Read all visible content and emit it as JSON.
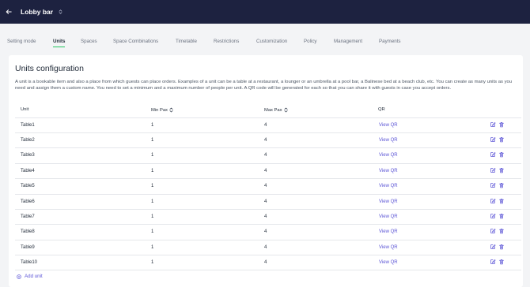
{
  "header": {
    "back_icon": "arrow-left-icon",
    "venue_name": "Lobby bar",
    "venue_caret_icon": "chevron-updown-icon"
  },
  "tabs": [
    {
      "label": "Setting mode",
      "active": false
    },
    {
      "label": "Units",
      "active": true
    },
    {
      "label": "Spaces",
      "active": false
    },
    {
      "label": "Space Combinations",
      "active": false
    },
    {
      "label": "Timetable",
      "active": false
    },
    {
      "label": "Restrictions",
      "active": false
    },
    {
      "label": "Customization",
      "active": false
    },
    {
      "label": "Policy",
      "active": false
    },
    {
      "label": "Management",
      "active": false
    },
    {
      "label": "Payments",
      "active": false
    }
  ],
  "main": {
    "title": "Units configuration",
    "description": "A unit is a bookable item and also a place from which guests can place orders. Examples of a unit can be a table at a restaurant, a lounger or an umbrella at a pool bar, a Balinese bed at a beach club, etc. You can create as many units as you need and assign them a custom name. You need to set a minimum and a maximum number of people per unit. A QR code will be generated for each so that you can share it with guests in case you accept orders."
  },
  "table": {
    "columns": [
      "Unit",
      "Min Pax",
      "Max Pax",
      "QR"
    ],
    "sort_icon": "sort-updown-icon",
    "rows": [
      {
        "unit": "Table1",
        "min_pax": "1",
        "max_pax": "4",
        "qr": "View QR"
      },
      {
        "unit": "Table2",
        "min_pax": "1",
        "max_pax": "4",
        "qr": "View QR"
      },
      {
        "unit": "Table3",
        "min_pax": "1",
        "max_pax": "4",
        "qr": "View QR"
      },
      {
        "unit": "Table4",
        "min_pax": "1",
        "max_pax": "4",
        "qr": "View QR"
      },
      {
        "unit": "Table5",
        "min_pax": "1",
        "max_pax": "4",
        "qr": "View QR"
      },
      {
        "unit": "Table6",
        "min_pax": "1",
        "max_pax": "4",
        "qr": "View QR"
      },
      {
        "unit": "Table7",
        "min_pax": "1",
        "max_pax": "4",
        "qr": "View QR"
      },
      {
        "unit": "Table8",
        "min_pax": "1",
        "max_pax": "4",
        "qr": "View QR"
      },
      {
        "unit": "Table9",
        "min_pax": "1",
        "max_pax": "4",
        "qr": "View QR"
      },
      {
        "unit": "Table10",
        "min_pax": "1",
        "max_pax": "4",
        "qr": "View QR"
      }
    ],
    "row_actions": [
      "edit-icon",
      "trash-icon"
    ]
  },
  "add_unit": {
    "label": "Add unit",
    "icon": "plus-circle-icon"
  },
  "colors": {
    "header_bg": "#1d2240",
    "accent": "#5b54d6",
    "active_tab_underline": "#22c55e",
    "page_bg": "#f3f4f6"
  }
}
